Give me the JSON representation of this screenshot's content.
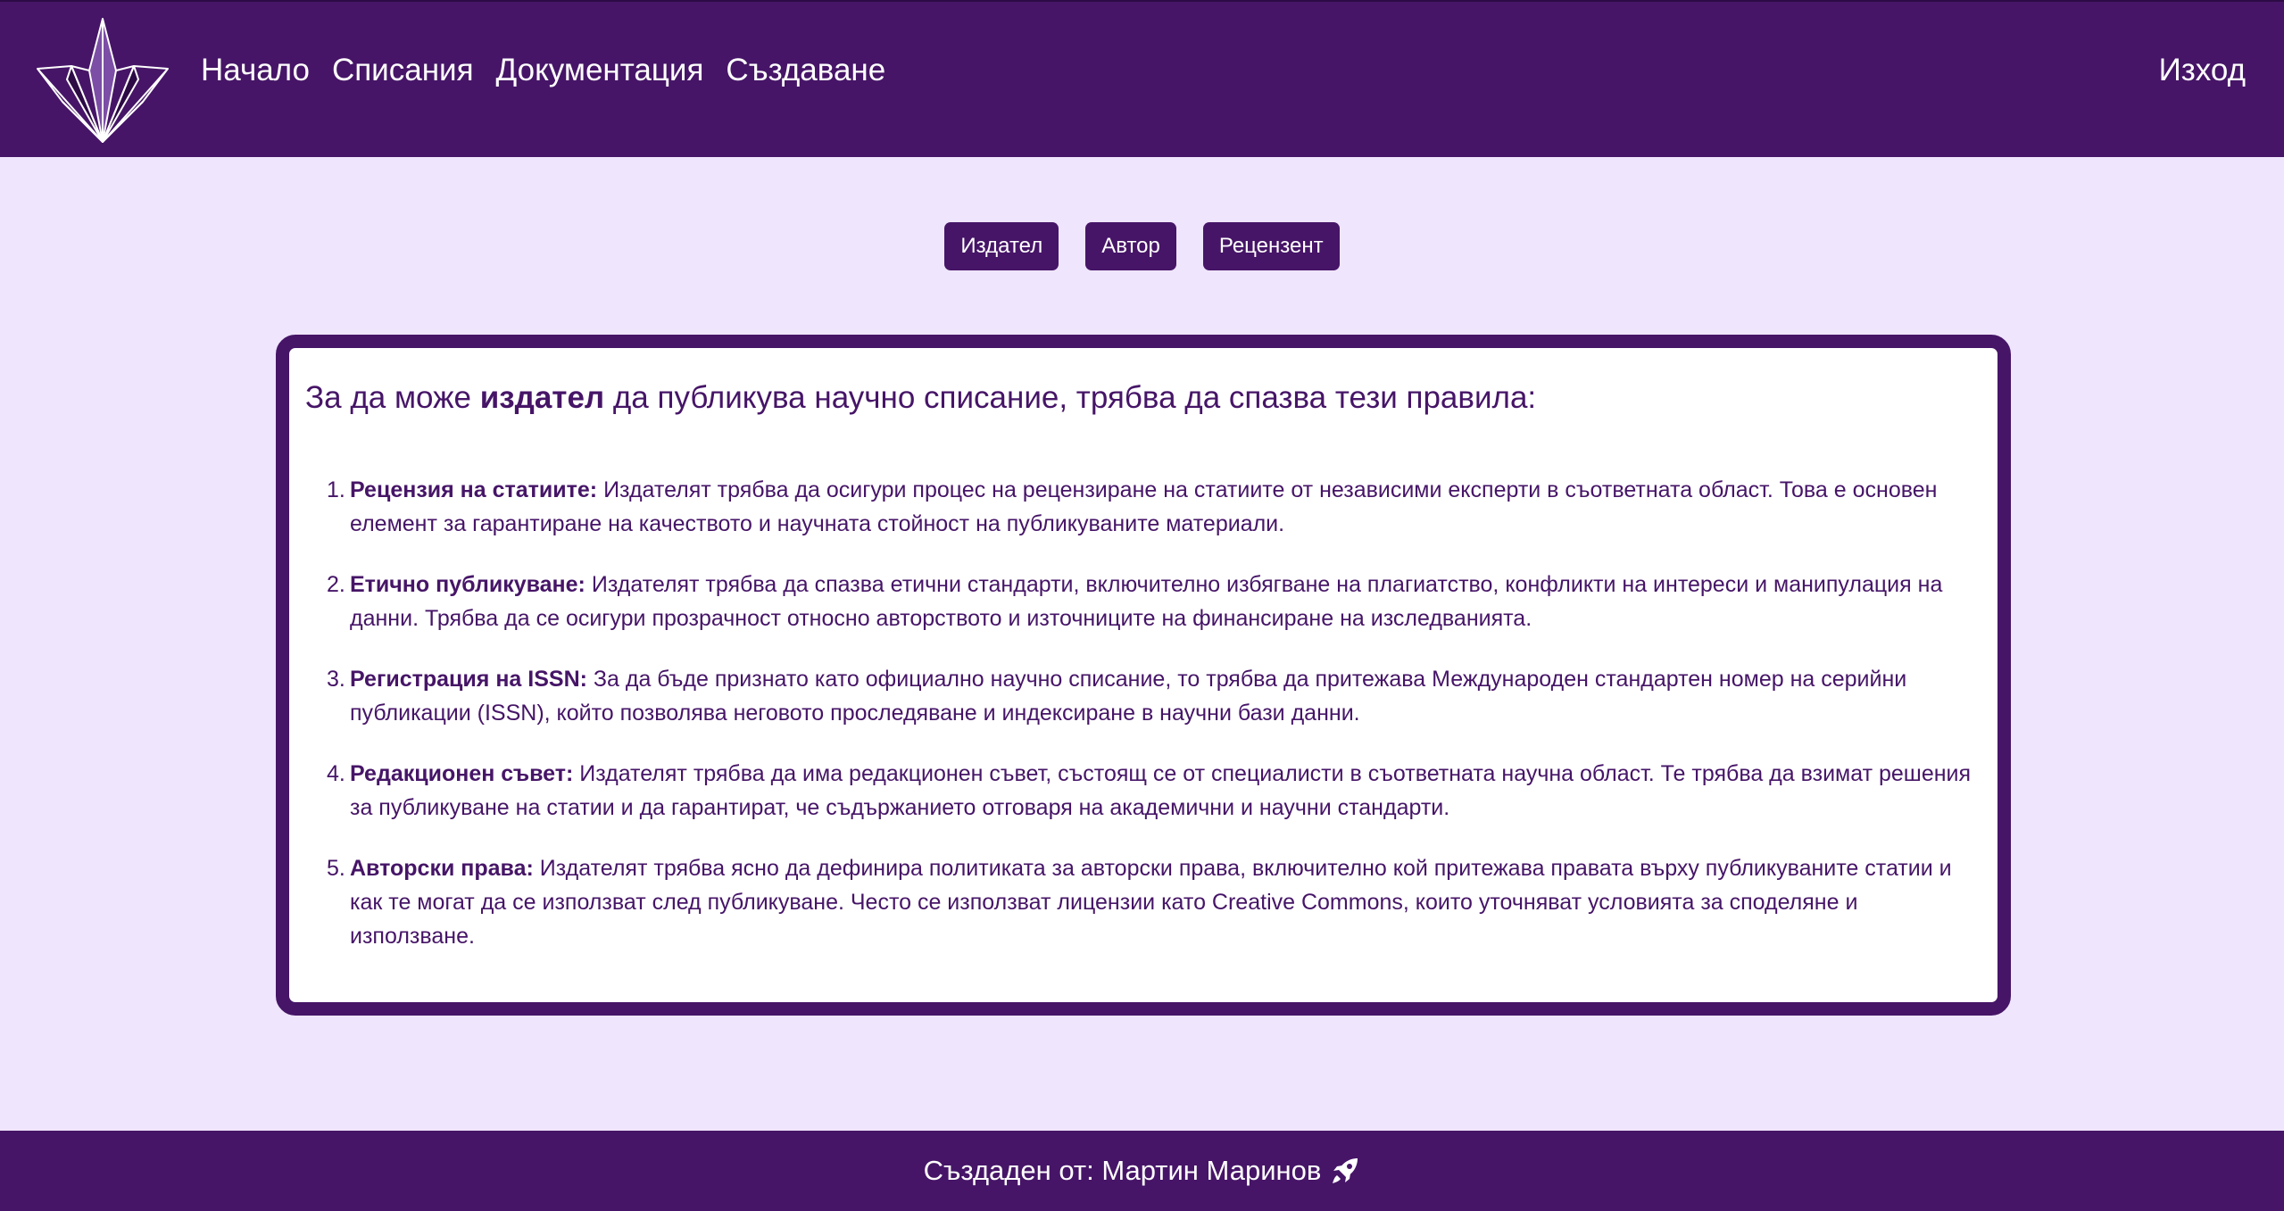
{
  "nav": {
    "links": [
      "Начало",
      "Списания",
      "Документация",
      "Създаване"
    ],
    "logout": "Изход"
  },
  "roles": {
    "tabs": [
      "Издател",
      "Автор",
      "Рецензент"
    ],
    "selected": "Издател"
  },
  "rules": {
    "title_prefix": "За да може",
    "title_role": "издател",
    "title_suffix": "да публикува научно списание, трябва да спазва тези правила:",
    "items": [
      {
        "num": "1.",
        "heading": "Рецензия на статиите:",
        "text": "Издателят трябва да осигури процес на рецензиране на статиите от независими експерти в съответната област. Това е основен елемент за гарантиране на качеството и научната стойност на публикуваните материали."
      },
      {
        "num": "2.",
        "heading": "Етично публикуване:",
        "text": "Издателят трябва да спазва етични стандарти, включително избягване на плагиатство, конфликти на интереси и манипулация на данни. Трябва да се осигури прозрачност относно авторството и източниците на финансиране на изследванията."
      },
      {
        "num": "3.",
        "heading": "Регистрация на ISSN:",
        "text": "За да бъде признато като официално научно списание, то трябва да притежава Международен стандартен номер на серийни публикации (ISSN), който позволява неговото проследяване и индексиране в научни бази данни."
      },
      {
        "num": "4.",
        "heading": "Редакционен съвет:",
        "text": "Издателят трябва да има редакционен съвет, състоящ се от специалисти в съответната научна област. Те трябва да взимат решения за публикуване на статии и да гарантират, че съдържанието отговаря на академични и научни стандарти."
      },
      {
        "num": "5.",
        "heading": "Авторски права:",
        "text": "Издателят трябва ясно да дефинира политиката за авторски права, включително кой притежава правата върху публикуваните статии и как те могат да се използват след публикуване. Често се използват лицензии като Creative Commons, които уточняват условията за споделяне и използване."
      }
    ]
  },
  "footer": {
    "text": "Създаден от: Мартин Маринов",
    "icon": "rocket-icon"
  },
  "colors": {
    "brand": "#461567",
    "background": "#efe5fd",
    "card": "#ffffff"
  }
}
